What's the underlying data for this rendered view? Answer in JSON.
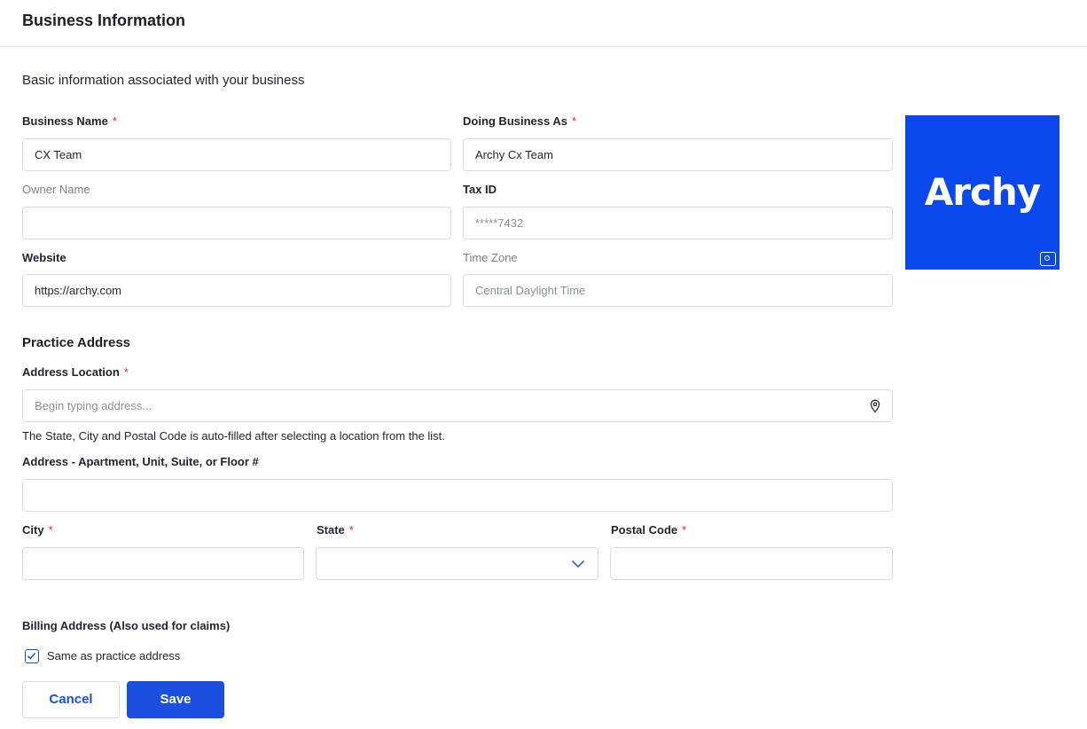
{
  "header": {
    "title": "Business Information"
  },
  "subtitle": "Basic information associated with your business",
  "required_mark": "*",
  "fields": {
    "business_name": {
      "label": "Business Name",
      "value": "CX Team"
    },
    "dba": {
      "label": "Doing Business As",
      "value": "Archy Cx Team"
    },
    "owner_name": {
      "label": "Owner Name",
      "value": ""
    },
    "tax_id": {
      "label": "Tax ID",
      "value": "*****7432"
    },
    "website": {
      "label": "Website",
      "value": "https://archy.com"
    },
    "time_zone": {
      "label": "Time Zone",
      "value": "Central Daylight Time"
    }
  },
  "logo": {
    "text": "Archy",
    "background": "#0a48ec",
    "icon": "camera-icon"
  },
  "practice_address": {
    "title": "Practice Address",
    "location": {
      "label": "Address Location",
      "placeholder": "Begin typing address...",
      "icon": "map-pin-icon"
    },
    "hint": "The State, City and Postal Code is auto-filled after selecting a location from the list.",
    "unit": {
      "label": "Address - Apartment, Unit, Suite, or Floor #",
      "value": ""
    },
    "city": {
      "label": "City",
      "value": ""
    },
    "state": {
      "label": "State",
      "value": "",
      "icon": "chevron-down-icon"
    },
    "postal_code": {
      "label": "Postal Code",
      "value": ""
    }
  },
  "billing": {
    "label": "Billing Address (Also used for claims)",
    "same_as_practice": {
      "label": "Same as practice address",
      "checked": true
    }
  },
  "actions": {
    "cancel_label": "Cancel",
    "save_label": "Save"
  },
  "colors": {
    "accent": "#1a4fe0",
    "required": "#e0252f",
    "border": "#d9dce2"
  }
}
